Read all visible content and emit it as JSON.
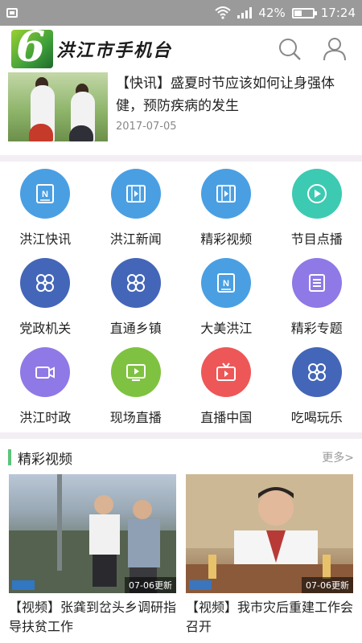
{
  "status_bar": {
    "battery_text": "42%",
    "battery_level": 0.42,
    "time": "17:24"
  },
  "header": {
    "app_title": "洪江市手机台",
    "icons": [
      "search-icon",
      "user-icon"
    ]
  },
  "top_news": {
    "title": "【快讯】盛夏时节应该如何让身强体健，预防疾病的发生",
    "date": "2017-07-05"
  },
  "grid": [
    {
      "label": "洪江快讯",
      "icon": "news-icon",
      "color": "#4a9fe3"
    },
    {
      "label": "洪江新闻",
      "icon": "film-icon",
      "color": "#4a9fe3"
    },
    {
      "label": "精彩视频",
      "icon": "film-icon",
      "color": "#4a9fe3"
    },
    {
      "label": "节目点播",
      "icon": "play-icon",
      "color": "#3ccab2"
    },
    {
      "label": "党政机关",
      "icon": "clover-icon",
      "color": "#4466b8"
    },
    {
      "label": "直通乡镇",
      "icon": "clover-icon",
      "color": "#4466b8"
    },
    {
      "label": "大美洪江",
      "icon": "news-icon",
      "color": "#4a9fe3"
    },
    {
      "label": "精彩专题",
      "icon": "list-icon",
      "color": "#8f79e6"
    },
    {
      "label": "洪江时政",
      "icon": "camera-icon",
      "color": "#8f79e6"
    },
    {
      "label": "现场直播",
      "icon": "play-screen-icon",
      "color": "#7fc241"
    },
    {
      "label": "直播中国",
      "icon": "tv-icon",
      "color": "#ee5757"
    },
    {
      "label": "吃喝玩乐",
      "icon": "clover-icon",
      "color": "#4466b8"
    }
  ],
  "videos_section": {
    "title": "精彩视频",
    "more": "更多>",
    "accent": "#5cc47a",
    "items": [
      {
        "title": "【视频】张龚到岔头乡调研指导扶贫工作",
        "badge": "07-06更新"
      },
      {
        "title": "【视频】我市灾后重建工作会召开",
        "badge": "07-06更新"
      }
    ]
  }
}
